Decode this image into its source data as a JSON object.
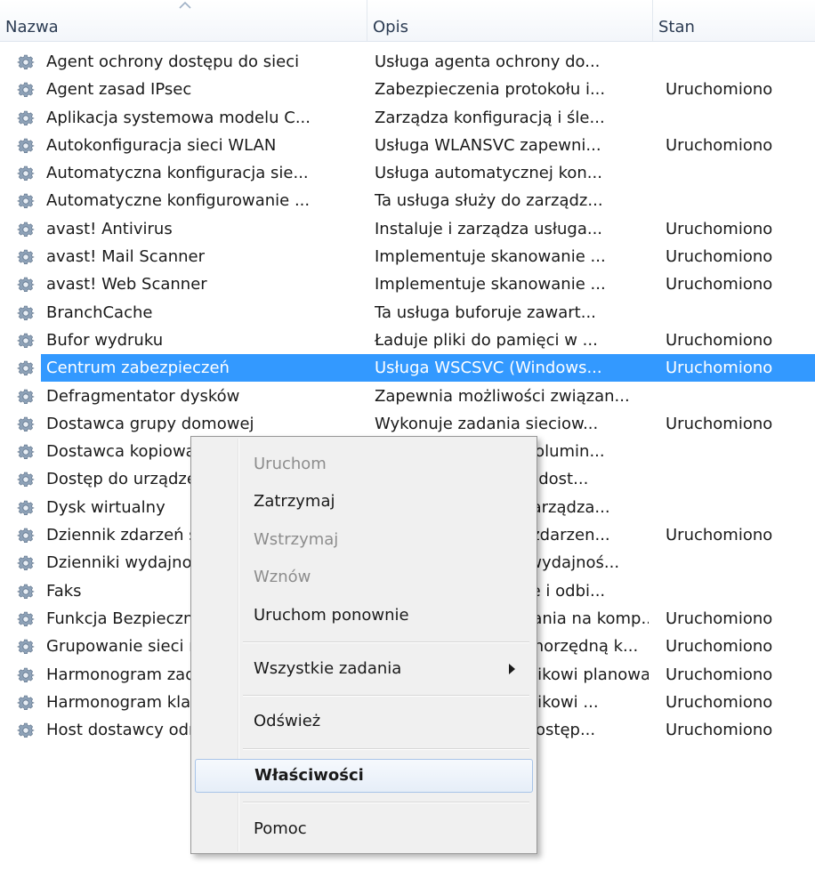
{
  "columns": {
    "name": "Nazwa",
    "description": "Opis",
    "status": "Stan"
  },
  "icons": {
    "service": "gear-service-icon",
    "sort": "sort-ascending-icon",
    "submenu": "chevron-right-icon"
  },
  "colors": {
    "selection": "#3399ff",
    "menu_bg": "#f0f0f0",
    "disabled_text": "#8d8d8d"
  },
  "rows": [
    {
      "name": "Agent ochrony dostępu do sieci",
      "description": "Usługa agenta ochrony do...",
      "status": ""
    },
    {
      "name": "Agent zasad IPsec",
      "description": "Zabezpieczenia protokołu i...",
      "status": "Uruchomiono"
    },
    {
      "name": "Aplikacja systemowa modelu C...",
      "description": "Zarządza konfiguracją i śle...",
      "status": ""
    },
    {
      "name": "Autokonfiguracja sieci WLAN",
      "description": "Usługa WLANSVC zapewni...",
      "status": "Uruchomiono"
    },
    {
      "name": "Automatyczna konfiguracja sie...",
      "description": "Usługa automatycznej kon...",
      "status": ""
    },
    {
      "name": "Automatyczne konfigurowanie ...",
      "description": "Ta usługa służy do zarządz...",
      "status": ""
    },
    {
      "name": "avast! Antivirus",
      "description": "Instaluje i zarządza usługa...",
      "status": "Uruchomiono"
    },
    {
      "name": "avast! Mail Scanner",
      "description": "Implementuje skanowanie ...",
      "status": "Uruchomiono"
    },
    {
      "name": "avast! Web Scanner",
      "description": "Implementuje skanowanie ...",
      "status": "Uruchomiono"
    },
    {
      "name": "BranchCache",
      "description": "Ta usługa buforuje zawart...",
      "status": ""
    },
    {
      "name": "Bufor wydruku",
      "description": "Ładuje pliki do pamięci w ...",
      "status": "Uruchomiono"
    },
    {
      "name": "Centrum zabezpieczeń",
      "description": "Usługa WSCSVC (Windows...",
      "status": "Uruchomiono"
    },
    {
      "name": "Defragmentator dysków",
      "description": "Zapewnia możliwości związan...",
      "status": ""
    },
    {
      "name": "Dostawca grupy domowej",
      "description": "Wykonuje zadania sieciow...",
      "status": "Uruchomiono"
    },
    {
      "name": "Dostawca kopiowania w tle",
      "description": "Zarządza kopiami wolumin...",
      "status": ""
    },
    {
      "name": "Dostęp do urządzeń HID",
      "description": "Włącza uniwersalny dost...",
      "status": ""
    },
    {
      "name": "Dysk wirtualny",
      "description": "Udostępnia usługi zarządza...",
      "status": ""
    },
    {
      "name": "Dziennik zdarzeń systemu Windows",
      "description": "Ta usługa zarządza zdarzen...",
      "status": "Uruchomiono"
    },
    {
      "name": "Dzienniki wydajności i alerty",
      "description": "Usługa dzienników wydajnoś...",
      "status": ""
    },
    {
      "name": "Faks",
      "description": "Umożliwia wysyłanie i odbi...",
      "status": ""
    },
    {
      "name": "Funkcja Bezpiecznego uruchamiania",
      "description": "Włącza opcje logowania na komp...",
      "status": "Uruchomiono"
    },
    {
      "name": "Grupowanie sieci równorzędnych",
      "description": "Zarządza siecią równorzędną k...",
      "status": "Uruchomiono"
    },
    {
      "name": "Harmonogram zadań",
      "description": "Umożliwia użytkownikowi planowanie wzgl...",
      "status": "Uruchomiono"
    },
    {
      "name": "Harmonogram klas multimediów",
      "description": "Umożliwia użytkownikowi ...",
      "status": "Uruchomiono"
    },
    {
      "name": "Host dostawcy odnajdowania f...",
      "description": "Usługa FDPHOST udostęp...",
      "status": "Uruchomiono"
    }
  ],
  "context_menu": {
    "start": "Uruchom",
    "stop": "Zatrzymaj",
    "pause": "Wstrzymaj",
    "resume": "Wznów",
    "restart": "Uruchom ponownie",
    "all_tasks": "Wszystkie zadania",
    "refresh": "Odśwież",
    "properties": "Właściwości",
    "help": "Pomoc"
  }
}
